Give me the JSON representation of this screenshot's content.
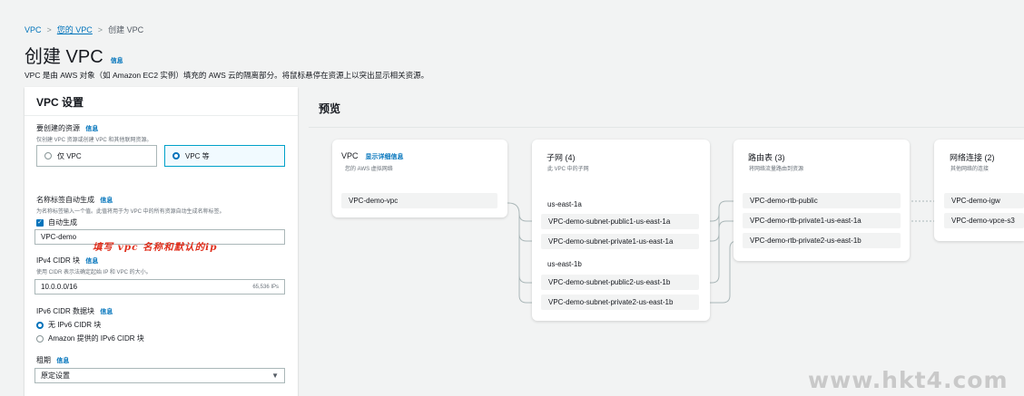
{
  "breadcrumb": {
    "root": "VPC",
    "sep1": ">",
    "mid": "您的 VPC",
    "sep2": ">",
    "current": "创建 VPC"
  },
  "page": {
    "title": "创建 VPC",
    "info": "信息",
    "description": "VPC 是由 AWS 对象（如 Amazon EC2 实例）填充的 AWS 云的隔离部分。将鼠标悬停在资源上以突出显示相关资源。"
  },
  "settings": {
    "header": "VPC 设置",
    "resources": {
      "label": "要创建的资源",
      "info": "信息",
      "hint": "仅创建 VPC 资源或创建 VPC 和其他联网资源。",
      "option_vpc_only": "仅 VPC",
      "option_vpc_more": "VPC 等"
    },
    "name_tag": {
      "label": "名称标签自动生成",
      "info": "信息",
      "hint": "为名称标签输入一个值。此值将用于为 VPC 中的所有资源自动生成名称标签。",
      "auto_label": "自动生成",
      "value": "VPC-demo"
    },
    "annotation": "填写 vpc 名称和默认的ip",
    "ipv4": {
      "label": "IPv4 CIDR 块",
      "info": "信息",
      "hint": "使用 CIDR 表示法确定起始 IP 和 VPC 的大小。",
      "value": "10.0.0.0/16",
      "count": "65,536 IPs"
    },
    "ipv6": {
      "label": "IPv6 CIDR 数据块",
      "info": "信息",
      "option_none": "无 IPv6 CIDR 块",
      "option_amazon": "Amazon 提供的 IPv6 CIDR 块"
    },
    "tenancy": {
      "label": "租期",
      "info": "信息",
      "value": "原定设置"
    }
  },
  "preview": {
    "header": "预览",
    "vpc": {
      "title": "VPC",
      "details_link": "显示详细信息",
      "subtitle": "您的 AWS 虚拟网络",
      "item": "VPC-demo-vpc"
    },
    "subnets": {
      "title": "子网 (4)",
      "subtitle": "此 VPC 中的子网",
      "az1": "us-east-1a",
      "az1_items": [
        "VPC-demo-subnet-public1-us-east-1a",
        "VPC-demo-subnet-private1-us-east-1a"
      ],
      "az2": "us-east-1b",
      "az2_items": [
        "VPC-demo-subnet-public2-us-east-1b",
        "VPC-demo-subnet-private2-us-east-1b"
      ]
    },
    "route_tables": {
      "title": "路由表 (3)",
      "subtitle": "将网络流量路由到资源",
      "items": [
        "VPC-demo-rtb-public",
        "VPC-demo-rtb-private1-us-east-1a",
        "VPC-demo-rtb-private2-us-east-1b"
      ]
    },
    "connections": {
      "title": "网络连接 (2)",
      "subtitle": "其他网络的连接",
      "items": [
        "VPC-demo-igw",
        "VPC-demo-vpce-s3"
      ]
    }
  },
  "watermark": "www.hkt4.com",
  "colors": {
    "link": "#0073bb",
    "selected_border": "#00a1c9",
    "annotation": "#e0301e"
  }
}
